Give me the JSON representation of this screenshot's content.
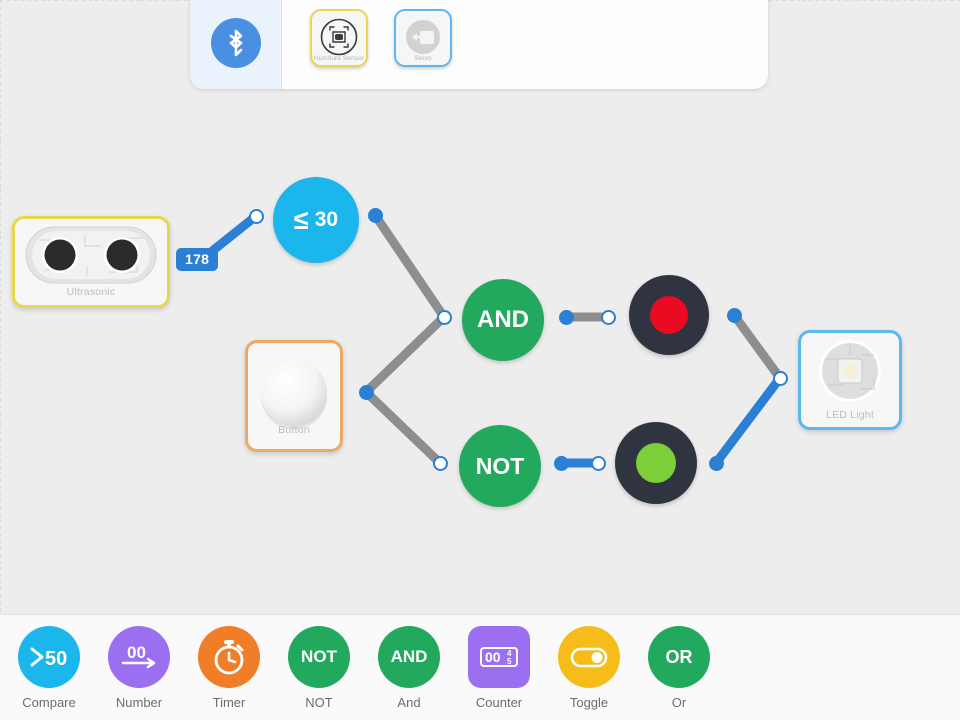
{
  "device_panel": {
    "bluetooth_icon": "bluetooth-icon",
    "devices": [
      {
        "label": "Humiture Sensor",
        "icon": "humiture-sensor-icon",
        "selected": true,
        "highlight": "#edd455"
      },
      {
        "label": "Servo",
        "icon": "servo-icon",
        "selected": true,
        "highlight": "#5cb8ef"
      }
    ]
  },
  "canvas": {
    "nodes": [
      {
        "id": "ultrasonic",
        "label": "Ultrasonic",
        "type": "sensor-card",
        "border_color": "#e9d64f"
      },
      {
        "id": "button",
        "label": "Button",
        "type": "sensor-card",
        "border_color": "#eda963"
      },
      {
        "id": "led",
        "label": "LED Light",
        "type": "actuator-card",
        "border_color": "#5cb8ef"
      },
      {
        "id": "compare",
        "label": "≤",
        "value": "30",
        "type": "compare-node",
        "color": "#1ab6ec"
      },
      {
        "id": "and",
        "label": "AND",
        "type": "logic-node",
        "color": "#22a95e"
      },
      {
        "id": "not",
        "label": "NOT",
        "type": "logic-node",
        "color": "#22a95e"
      },
      {
        "id": "indicator-red",
        "type": "indicator",
        "state": "off",
        "bulb_color": "#ea0a22"
      },
      {
        "id": "indicator-green",
        "type": "indicator",
        "state": "on",
        "bulb_color": "#7ed03a"
      }
    ],
    "value_badge": {
      "value": "178",
      "color": "#2b7fd4"
    },
    "wire_colors": {
      "active": "#2b7fd4",
      "inactive": "#8e8e8e"
    }
  },
  "toolbar": {
    "items": [
      {
        "label": "Compare",
        "glyph": ">50",
        "icon": "compare-icon",
        "color": "#1ab6ec",
        "shape": "circle"
      },
      {
        "label": "Number",
        "glyph": "00",
        "icon": "number-icon",
        "color": "#9b6ff0",
        "shape": "circle"
      },
      {
        "label": "Timer",
        "glyph": "",
        "icon": "stopwatch-icon",
        "color": "#f07d27",
        "shape": "circle"
      },
      {
        "label": "NOT",
        "glyph": "NOT",
        "icon": "not-icon",
        "color": "#22a95e",
        "shape": "circle"
      },
      {
        "label": "And",
        "glyph": "AND",
        "icon": "and-icon",
        "color": "#22a95e",
        "shape": "circle"
      },
      {
        "label": "Counter",
        "glyph": "00",
        "icon": "counter-icon",
        "color": "#9b6ff0",
        "shape": "square"
      },
      {
        "label": "Toggle",
        "glyph": "",
        "icon": "toggle-icon",
        "color": "#f5bc1a",
        "shape": "circle"
      },
      {
        "label": "Or",
        "glyph": "OR",
        "icon": "or-icon",
        "color": "#22a95e",
        "shape": "circle"
      }
    ]
  }
}
